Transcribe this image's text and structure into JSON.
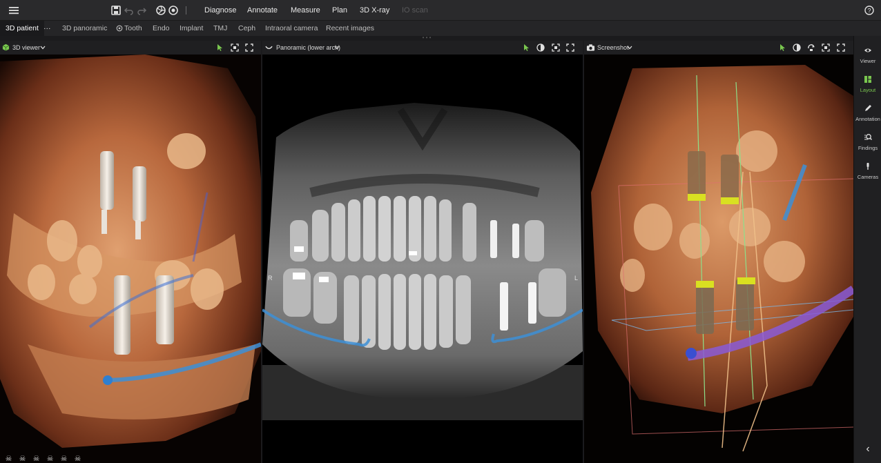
{
  "menubar": {
    "items": [
      "Diagnose",
      "Annotate",
      "Measure",
      "Plan",
      "3D X-ray",
      "IO scan"
    ],
    "disabled_item": "IO scan",
    "icons": [
      "hamburger-menu-icon",
      "save-icon",
      "undo-icon",
      "redo-icon",
      "aperture-icon",
      "target-icon",
      "help-icon"
    ]
  },
  "tabs": {
    "active": "3D patient",
    "more": "···",
    "items": [
      "3D panoramic",
      "Tooth",
      "Endo",
      "Implant",
      "TMJ",
      "Ceph",
      "Intraoral camera",
      "Recent images"
    ]
  },
  "panes": {
    "viewer3d": {
      "title": "3D viewer"
    },
    "panoramic": {
      "title": "Panoramic (lower arch)"
    },
    "screenshot": {
      "title": "Screenshot"
    }
  },
  "panoramic_labels": {
    "left": "R",
    "right": "L"
  },
  "sidebar": {
    "items": [
      {
        "label": "Viewer",
        "icon": "eye-icon"
      },
      {
        "label": "Layout",
        "icon": "layout-icon",
        "active": true
      },
      {
        "label": "Annotation",
        "icon": "pencil-icon"
      },
      {
        "label": "Findings",
        "icon": "findings-search-icon"
      },
      {
        "label": "Cameras",
        "icon": "camera-probe-icon"
      }
    ],
    "collapse": "‹"
  },
  "colors": {
    "accent_green": "#7ac74f",
    "nerve_blue": "#3d8fd6",
    "implant_yellow": "#d9e021",
    "bone": "#c97a4a"
  }
}
